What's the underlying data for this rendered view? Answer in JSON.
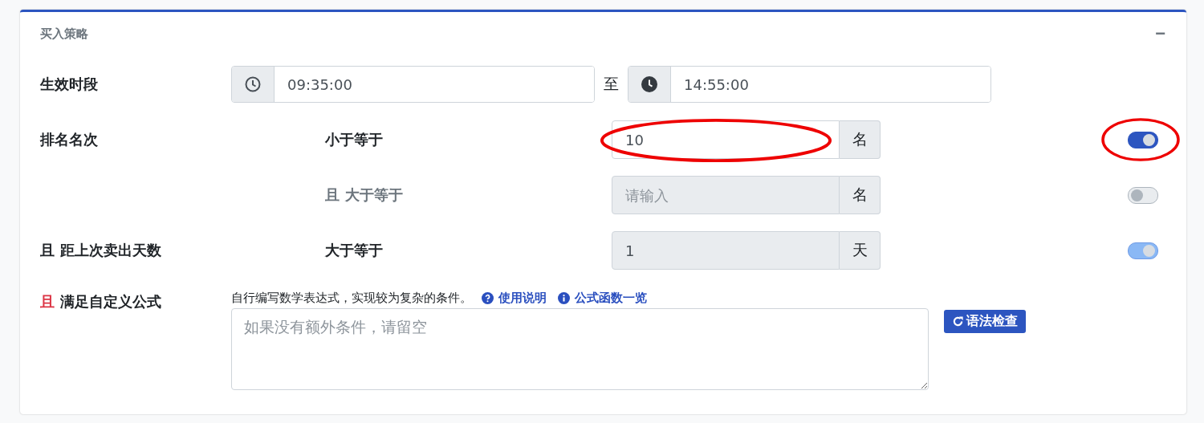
{
  "card": {
    "title": "买入策略",
    "collapse_symbol": "−"
  },
  "time_range": {
    "label": "生效时段",
    "start": "09:35:00",
    "separator": "至",
    "end": "14:55:00"
  },
  "conditions": [
    {
      "label": "排名名次",
      "operator": "小于等于",
      "value": "10",
      "unit": "名",
      "enabled": true,
      "disabled": false,
      "circled": true
    },
    {
      "connector": "且",
      "operator": "大于等于",
      "placeholder": "请输入",
      "unit": "名",
      "enabled": false,
      "disabled": true,
      "circled": false
    },
    {
      "connector": "且",
      "label": "距上次卖出天数",
      "operator": "大于等于",
      "value": "1",
      "unit": "天",
      "enabled": true,
      "disabled": true,
      "circled": false
    }
  ],
  "formula": {
    "connector": "且",
    "label": "满足自定义公式",
    "hint": "自行编写数学表达式，实现较为复杂的条件。",
    "links": [
      {
        "kind": "help",
        "label": "使用说明"
      },
      {
        "kind": "info",
        "label": "公式函数一览"
      }
    ],
    "placeholder": "如果没有额外条件，请留空",
    "button": "语法检查"
  }
}
